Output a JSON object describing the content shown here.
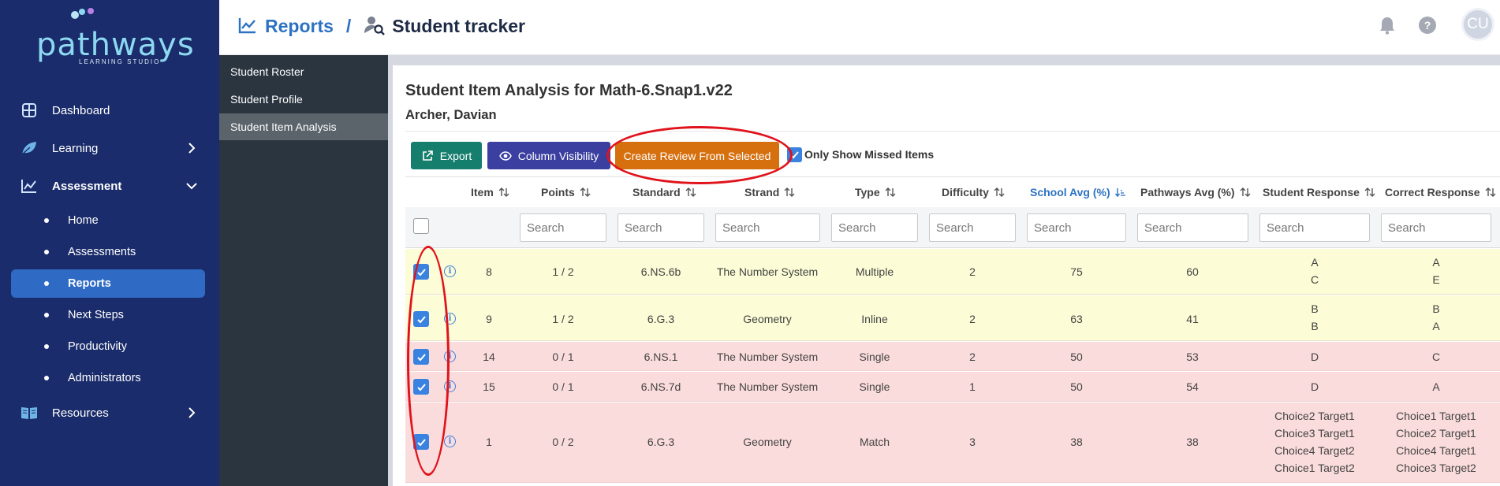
{
  "app": {
    "logo_text": "pathways",
    "logo_subtext": "LEARNING STUDIO",
    "avatar_initials": "CU"
  },
  "nav": {
    "items": [
      {
        "label": "Dashboard",
        "icon": "grid-icon"
      },
      {
        "label": "Learning",
        "icon": "leaf-icon"
      },
      {
        "label": "Assessment",
        "icon": "chart-icon"
      },
      {
        "label": "Resources",
        "icon": "book-icon"
      }
    ],
    "assessment_sub": [
      {
        "label": "Home"
      },
      {
        "label": "Assessments"
      },
      {
        "label": "Reports"
      },
      {
        "label": "Next Steps"
      },
      {
        "label": "Productivity"
      },
      {
        "label": "Administrators"
      }
    ]
  },
  "header": {
    "breadcrumb_root": "Reports",
    "separator": "/",
    "breadcrumb_current": "Student tracker"
  },
  "subnav": {
    "items": [
      {
        "label": "Student Roster"
      },
      {
        "label": "Student Profile"
      },
      {
        "label": "Student Item Analysis"
      }
    ]
  },
  "page": {
    "title": "Student Item Analysis for Math-6.Snap1.v22",
    "student": "Archer, Davian"
  },
  "toolbar": {
    "export": "Export",
    "column_visibility": "Column Visibility",
    "create_review": "Create Review From Selected",
    "only_missed": "Only Show Missed Items"
  },
  "table": {
    "columns": [
      "Item",
      "Points",
      "Standard",
      "Strand",
      "Type",
      "Difficulty",
      "School Avg (%)",
      "Pathways Avg (%)",
      "Student Response",
      "Correct Response"
    ],
    "search_placeholder": "Search",
    "rows": [
      {
        "item": "8",
        "points": "1 / 2",
        "standard": "6.NS.6b",
        "strand": "The Number System",
        "type": "Multiple",
        "difficulty": "2",
        "school_avg": "75",
        "pathways_avg": "60",
        "student_response": [
          "A",
          "C"
        ],
        "correct_response": [
          "A",
          "E"
        ],
        "status": "partial"
      },
      {
        "item": "9",
        "points": "1 / 2",
        "standard": "6.G.3",
        "strand": "Geometry",
        "type": "Inline",
        "difficulty": "2",
        "school_avg": "63",
        "pathways_avg": "41",
        "student_response": [
          "B",
          "B"
        ],
        "correct_response": [
          "B",
          "A"
        ],
        "status": "partial"
      },
      {
        "item": "14",
        "points": "0 / 1",
        "standard": "6.NS.1",
        "strand": "The Number System",
        "type": "Single",
        "difficulty": "2",
        "school_avg": "50",
        "pathways_avg": "53",
        "student_response": [
          "D"
        ],
        "correct_response": [
          "C"
        ],
        "status": "incorrect"
      },
      {
        "item": "15",
        "points": "0 / 1",
        "standard": "6.NS.7d",
        "strand": "The Number System",
        "type": "Single",
        "difficulty": "1",
        "school_avg": "50",
        "pathways_avg": "54",
        "student_response": [
          "D"
        ],
        "correct_response": [
          "A"
        ],
        "status": "incorrect"
      },
      {
        "item": "1",
        "points": "0 / 2",
        "standard": "6.G.3",
        "strand": "Geometry",
        "type": "Match",
        "difficulty": "3",
        "school_avg": "38",
        "pathways_avg": "38",
        "student_response": [
          "Choice2 Target1",
          "Choice3 Target1",
          "Choice4 Target2",
          "Choice1 Target2"
        ],
        "correct_response": [
          "Choice1 Target1",
          "Choice2 Target1",
          "Choice4 Target1",
          "Choice3 Target2"
        ],
        "status": "incorrect"
      }
    ]
  },
  "colors": {
    "nav_bg": "#1a2c6b",
    "accent_blue": "#2d72c2",
    "export_btn": "#167e6d",
    "colvis_btn": "#3a3fa0",
    "review_btn": "#d6700f",
    "partial_row": "#fcfcd6",
    "incorrect_row": "#fbdcdc",
    "annotation": "#e0131c"
  }
}
